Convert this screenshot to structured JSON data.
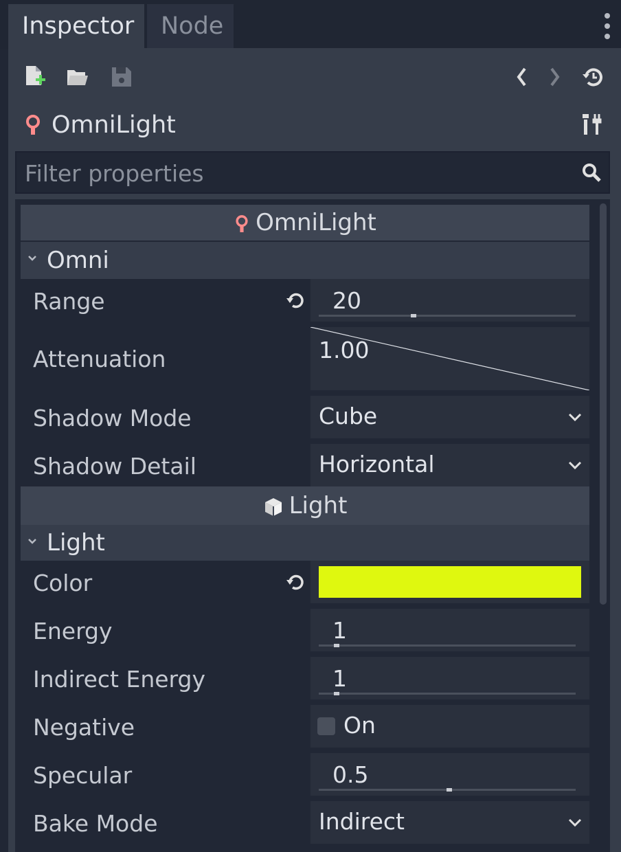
{
  "tabs": {
    "inspector": "Inspector",
    "node": "Node"
  },
  "object": {
    "name": "OmniLight"
  },
  "filter": {
    "placeholder": "Filter properties",
    "value": ""
  },
  "categories": {
    "omnilight": "OmniLight",
    "light": "Light"
  },
  "sections": {
    "omni": "Omni",
    "light": "Light"
  },
  "properties": {
    "range": {
      "label": "Range",
      "value": "20"
    },
    "attenuation": {
      "label": "Attenuation",
      "value": "1.00"
    },
    "shadow_mode": {
      "label": "Shadow Mode",
      "value": "Cube"
    },
    "shadow_detail": {
      "label": "Shadow Detail",
      "value": "Horizontal"
    },
    "color": {
      "label": "Color",
      "swatch": "#dff80f"
    },
    "energy": {
      "label": "Energy",
      "value": "1"
    },
    "indirect_energy": {
      "label": "Indirect Energy",
      "value": "1"
    },
    "negative": {
      "label": "Negative",
      "checkbox_label": "On",
      "checked": false
    },
    "specular": {
      "label": "Specular",
      "value": "0.5"
    },
    "bake_mode": {
      "label": "Bake Mode",
      "value": "Indirect"
    }
  },
  "colors": {
    "light_icon": "#ff8c8c",
    "background": "#212735",
    "panel": "#363d4a"
  },
  "icons": [
    "kebab-menu-icon",
    "new-resource-icon",
    "open-folder-icon",
    "save-icon",
    "history-back-icon",
    "history-forward-icon",
    "object-history-icon",
    "omnilight-icon",
    "object-properties-icon",
    "search-icon",
    "revert-icon",
    "light-category-icon",
    "chevron-down-icon",
    "dropdown-arrow-icon"
  ]
}
